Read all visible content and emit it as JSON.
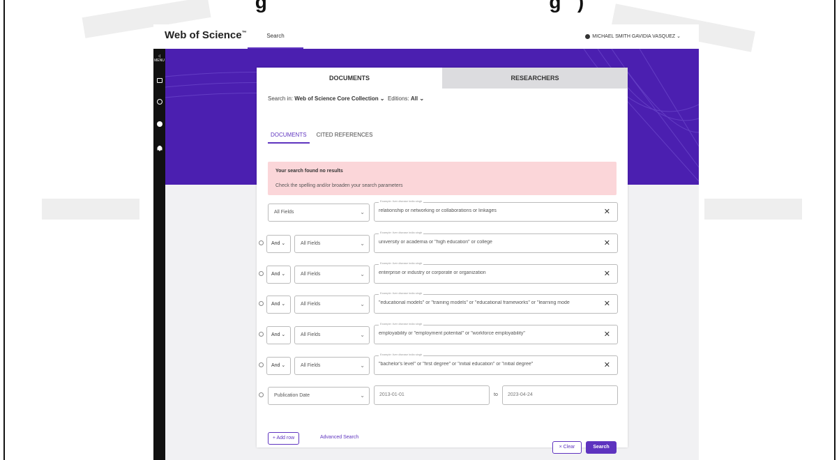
{
  "caption": {
    "text": "g                                                    g   )"
  },
  "header": {
    "brand": "Web of Science",
    "brand_mark": "™",
    "tab": "Search",
    "user": "MICHAEL SMITH GAVIDIA VASQUEZ ⌄"
  },
  "sidenav": {
    "menu": "MENU"
  },
  "tabs": {
    "documents": "DOCUMENTS",
    "researchers": "RESEARCHERS"
  },
  "search_in": {
    "prefix": "Search in:",
    "collection": "Web of Science Core Collection ⌄",
    "editions_prefix": "Editions:",
    "editions": "All ⌄"
  },
  "subtabs": {
    "documents": "DOCUMENTS",
    "cited": "CITED REFERENCES"
  },
  "alert": {
    "title": "Your search found no results",
    "subtitle": "Check the spelling and/or broaden your search parameters"
  },
  "rows": [
    {
      "bool": "",
      "field": "All Fields",
      "label": "Example: liver disease india singh",
      "query": "relationship or networking or collaborations or linkages"
    },
    {
      "bool": "And ⌄",
      "field": "All Fields",
      "label": "Example: liver disease india singh",
      "query": "university or academia or \"high education\" or college"
    },
    {
      "bool": "And ⌄",
      "field": "All Fields",
      "label": "Example: liver disease india singh",
      "query": "enterprise or industry or corporate or organization"
    },
    {
      "bool": "And ⌄",
      "field": "All Fields",
      "label": "Example: liver disease india singh",
      "query": "\"educational models\" or \"training models\" or \"educational frameworks\" or \"learning mode"
    },
    {
      "bool": "And ⌄",
      "field": "All Fields",
      "label": "Example: liver disease india singh",
      "query": "employability or \"employment potential\" or \"workforce employability\""
    },
    {
      "bool": "And ⌄",
      "field": "All Fields",
      "label": "Example: liver disease india singh",
      "query": "\"bachelor's level\" or \"first degree\" or \"initial education\" or \"initial degree\""
    }
  ],
  "date_row": {
    "field": "Publication Date",
    "from": "2013-01-01",
    "to_label": "to",
    "to": "2023-04-24"
  },
  "actions": {
    "add_row": "+ Add row",
    "advanced": "Advanced Search",
    "clear": "× Clear",
    "search": "Search"
  },
  "colors": {
    "accent": "#5e33bf",
    "hero": "#4b1fb0",
    "alert_bg": "#fbd6d9"
  },
  "icons": [
    "menu-icon",
    "folder-icon",
    "history-icon",
    "user-icon",
    "bell-icon",
    "close-icon",
    "chevron-down-icon",
    "minus-circle-icon"
  ]
}
